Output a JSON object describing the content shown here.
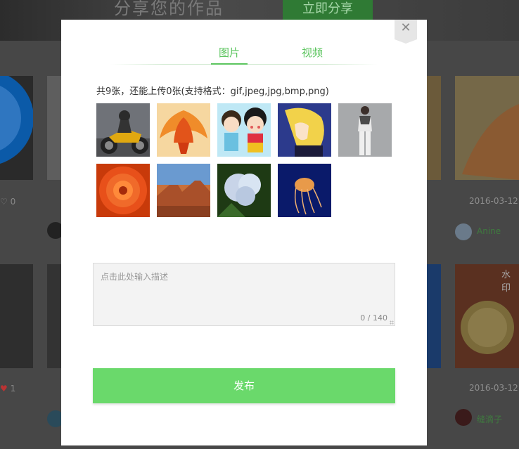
{
  "background": {
    "header_title": "分享您的作品",
    "share_button": "立即分享",
    "cards": [
      {
        "like_count": "0",
        "date": "2016-03-12",
        "user": "Anine"
      },
      {
        "like_count": "1",
        "date": "2016-03-12",
        "user": "缝滴子"
      }
    ],
    "watermark": "水印"
  },
  "modal": {
    "close_symbol": "✕",
    "tabs": [
      {
        "label": "图片",
        "active": true
      },
      {
        "label": "视频",
        "active": false
      }
    ],
    "upload_info": "共9张，还能上传0张(支持格式：gif,jpeg,jpg,bmp,png)",
    "thumbnails": [
      {
        "subject": "motorcycle"
      },
      {
        "subject": "phoenix-illustration"
      },
      {
        "subject": "cartoon-girls"
      },
      {
        "subject": "anime-character"
      },
      {
        "subject": "fashion-model"
      },
      {
        "subject": "red-flower"
      },
      {
        "subject": "desert-landscape"
      },
      {
        "subject": "hydrangea"
      },
      {
        "subject": "jellyfish"
      }
    ],
    "description": {
      "placeholder": "点击此处输入描述",
      "value": "",
      "counter": "0 / 140"
    },
    "publish_label": "发布"
  },
  "colors": {
    "accent": "#5cc55f",
    "publish_button": "#6ad96b",
    "overlay": "#3a3a3a"
  }
}
